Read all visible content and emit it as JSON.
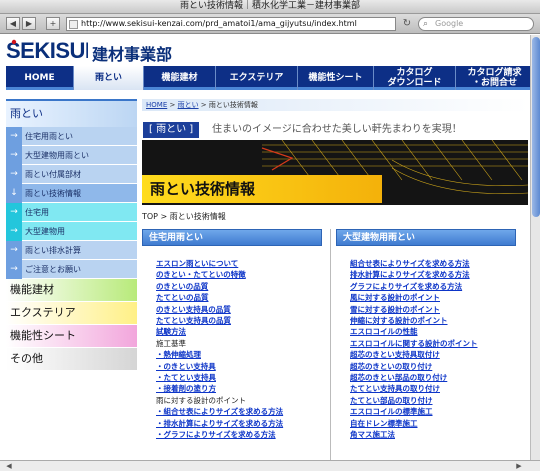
{
  "window": {
    "title": "雨とい技術情報｜積水化学工業－建材事業部"
  },
  "toolbar": {
    "back_icon": "back-arrow-icon",
    "forward_icon": "forward-arrow-icon",
    "add_label": "+",
    "url": "http://www.sekisui-kenzai.com/prd_amatoi1/ama_gijyutsu/index.html",
    "reload_icon": "reload-icon",
    "search_placeholder": "Google"
  },
  "header": {
    "logo_text": "SEKISUI",
    "division": "建材事業部"
  },
  "gnav": [
    {
      "label": "HOME",
      "active": false
    },
    {
      "label": "雨とい",
      "active": true
    },
    {
      "label": "機能建材",
      "active": false
    },
    {
      "label": "エクステリア",
      "active": false
    },
    {
      "label": "機能性シート",
      "active": false
    },
    {
      "label": "カタログ\nダウンロード",
      "active": false
    },
    {
      "label": "カタログ請求\n・お問合せ",
      "active": false
    }
  ],
  "sidebar": {
    "heading": "雨とい",
    "items": [
      {
        "label": "住宅用雨とい",
        "type": "normal"
      },
      {
        "label": "大型建物用雨とい",
        "type": "normal"
      },
      {
        "label": "雨とい付属部材",
        "type": "normal"
      },
      {
        "label": "雨とい技術情報",
        "type": "current"
      },
      {
        "label": "住宅用",
        "type": "sub"
      },
      {
        "label": "大型建物用",
        "type": "sub"
      },
      {
        "label": "雨とい排水計算",
        "type": "normal"
      },
      {
        "label": "ご注意とお願い",
        "type": "normal"
      }
    ],
    "categories": [
      {
        "label": "機能建材"
      },
      {
        "label": "エクステリア"
      },
      {
        "label": "機能性シート"
      },
      {
        "label": "その他"
      }
    ]
  },
  "breadcrumb": {
    "home": "HOME",
    "sep1": " > ",
    "section": "雨とい",
    "sep2": " > ",
    "current": "雨とい技術情報"
  },
  "tagline": {
    "tag": "[ 雨とい ]",
    "text": "住まいのイメージに合わせた美しい軒先まわりを実現！"
  },
  "banner": {
    "title": "雨とい技術情報"
  },
  "breadcrumb2": "TOP > 雨とい技術情報",
  "residential": {
    "heading": "住宅用雨とい",
    "links": [
      {
        "text": "エスロン雨といについて",
        "link": true
      },
      {
        "text": "のきとい・たてといの特徴",
        "link": true
      },
      {
        "text": "のきといの品質",
        "link": true
      },
      {
        "text": "たてといの品質",
        "link": true
      },
      {
        "text": "のきとい支持具の品質",
        "link": true
      },
      {
        "text": "たてとい支持具の品質",
        "link": true
      },
      {
        "text": "試験方法",
        "link": true
      },
      {
        "text": "施工基準",
        "link": false
      },
      {
        "text": "・熱伸縮処理",
        "link": true
      },
      {
        "text": "・のきとい支持具",
        "link": true
      },
      {
        "text": "・たてとい支持具",
        "link": true
      },
      {
        "text": "・接着剤の塗り方",
        "link": true
      },
      {
        "text": "雨に対する設計のポイント",
        "link": false
      },
      {
        "text": "・組合せ表によりサイズを求める方法",
        "link": true
      },
      {
        "text": "・排水計算によりサイズを求める方法",
        "link": true
      },
      {
        "text": "・グラフによりサイズを求める方法",
        "link": true
      }
    ]
  },
  "large": {
    "heading": "大型建物用雨とい",
    "links": [
      {
        "text": "組合せ表によりサイズを求める方法",
        "link": true
      },
      {
        "text": "排水計算によりサイズを求める方法",
        "link": true
      },
      {
        "text": "グラフによりサイズを求める方法",
        "link": true
      },
      {
        "text": "風に対する設計のポイント",
        "link": true
      },
      {
        "text": "雪に対する設計のポイント",
        "link": true
      },
      {
        "text": "伸縮に対する設計のポイント",
        "link": true
      },
      {
        "text": "エスロコイルの性能",
        "link": true
      },
      {
        "text": "エスロコイルに関する設計のポイント",
        "link": true
      },
      {
        "text": "超芯のきとい支持具取付け",
        "link": true
      },
      {
        "text": "超芯のきといの取り付け",
        "link": true
      },
      {
        "text": "超芯のきとい部品の取り付け",
        "link": true
      },
      {
        "text": "たてとい支持具の取り付け",
        "link": true
      },
      {
        "text": "たてとい部品の取り付け",
        "link": true
      },
      {
        "text": "エスロコイルの標準施工",
        "link": true
      },
      {
        "text": "自在ドレン標準施工",
        "link": true
      },
      {
        "text": "角マス施工法",
        "link": true
      }
    ]
  },
  "colors": {
    "nav_blue": "#0d2f86",
    "link_blue": "#0d35c8",
    "banner_yellow": "#ffdc1e"
  }
}
